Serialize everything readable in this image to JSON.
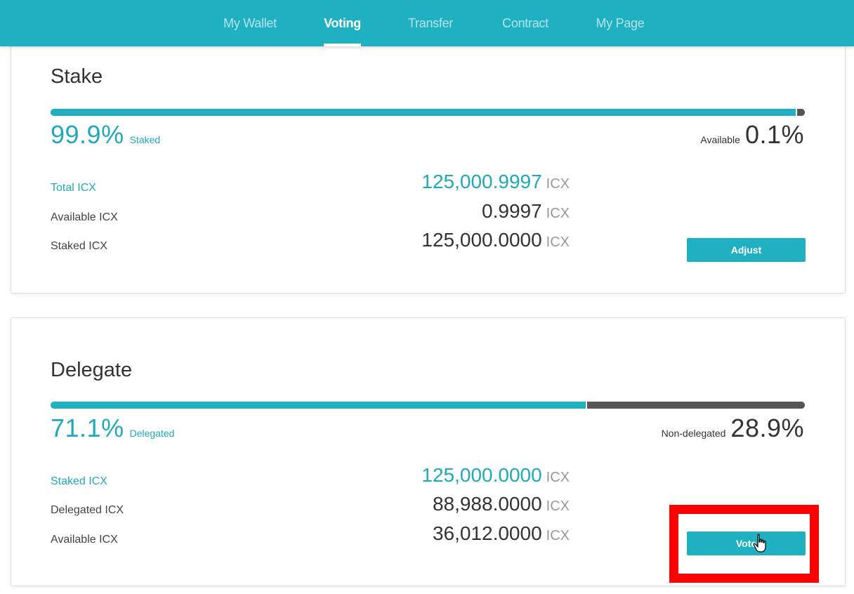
{
  "nav": {
    "items": [
      {
        "label": "My Wallet",
        "active": false
      },
      {
        "label": "Voting",
        "active": true
      },
      {
        "label": "Transfer",
        "active": false
      },
      {
        "label": "Contract",
        "active": false
      },
      {
        "label": "My Page",
        "active": false
      }
    ]
  },
  "stake": {
    "title": "Stake",
    "staked_percent": "99.9%",
    "staked_label": "Staked",
    "available_label": "Available",
    "available_percent": "0.1%",
    "progress_fraction": 0.999,
    "rows": [
      {
        "label": "Total ICX",
        "value": "125,000.9997",
        "unit": "ICX",
        "accent": true
      },
      {
        "label": "Available ICX",
        "value": "0.9997",
        "unit": "ICX",
        "accent": false
      },
      {
        "label": "Staked ICX",
        "value": "125,000.0000",
        "unit": "ICX",
        "accent": false
      }
    ],
    "button_label": "Adjust"
  },
  "delegate": {
    "title": "Delegate",
    "delegated_percent": "71.1%",
    "delegated_label": "Delegated",
    "nondelegated_label": "Non-delegated",
    "nondelegated_percent": "28.9%",
    "progress_fraction": 0.711,
    "rows": [
      {
        "label": "Staked ICX",
        "value": "125,000.0000",
        "unit": "ICX",
        "accent": true
      },
      {
        "label": "Delegated ICX",
        "value": "88,988.0000",
        "unit": "ICX",
        "accent": false
      },
      {
        "label": "Available ICX",
        "value": "36,012.0000",
        "unit": "ICX",
        "accent": false
      }
    ],
    "button_label": "Vote"
  },
  "colors": {
    "accent": "#1fb1c2",
    "bar_remainder": "#555555",
    "highlight": "#ff0000"
  },
  "icons": {
    "cursor": "hand-pointer-icon"
  }
}
